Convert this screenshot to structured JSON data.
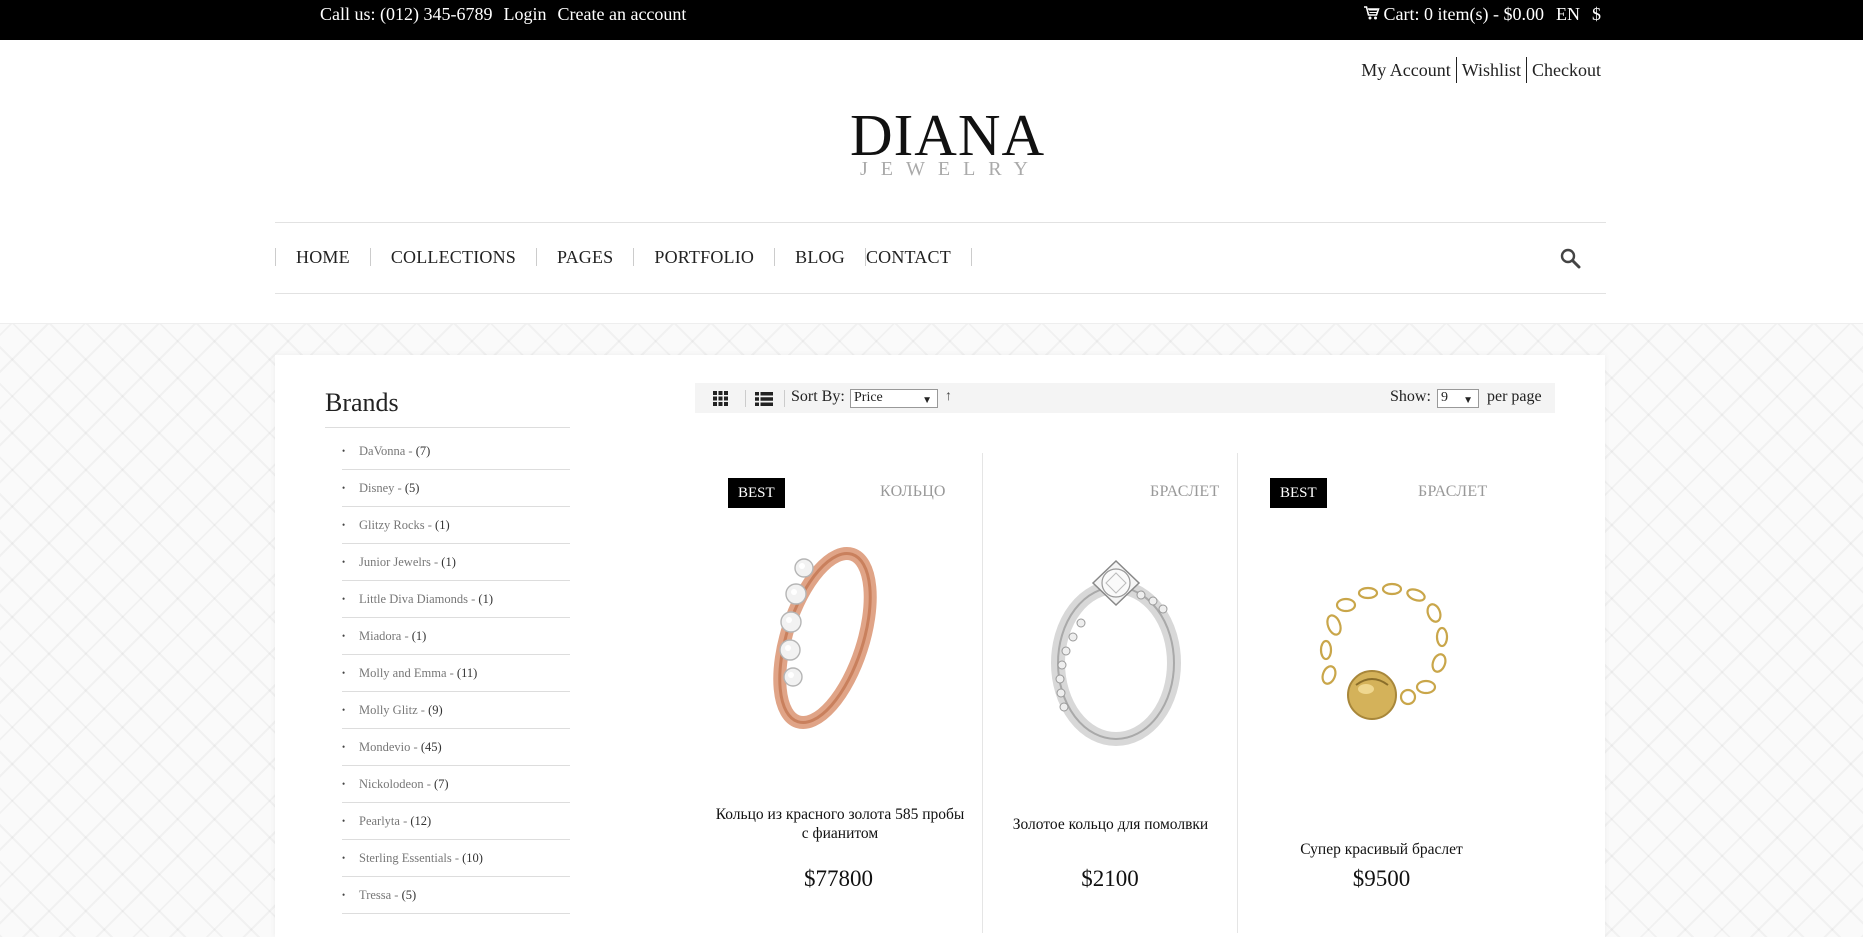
{
  "topbar": {
    "phone": "Call us: (012) 345-6789",
    "login": "Login",
    "create_account": "Create an account",
    "cart": "Cart: 0 item(s) - $0.00",
    "language": "EN",
    "currency": "$"
  },
  "header": {
    "links": [
      "My Account",
      "Wishlist",
      "Checkout"
    ],
    "logo_main": "DIANA",
    "logo_sub": "JEWELRY"
  },
  "nav": {
    "items": [
      "HOME",
      "COLLECTIONS",
      "PAGES",
      "PORTFOLIO",
      "BLOG",
      "CONTACT"
    ]
  },
  "sidebar": {
    "title": "Brands",
    "brands": [
      {
        "name": "DaVonna - ",
        "count": "(7)"
      },
      {
        "name": "Disney - ",
        "count": "(5)"
      },
      {
        "name": "Glitzy Rocks - ",
        "count": "(1)"
      },
      {
        "name": "Junior Jewelrs - ",
        "count": "(1)"
      },
      {
        "name": "Little Diva Diamonds - ",
        "count": "(1)"
      },
      {
        "name": "Miadora - ",
        "count": "(1)"
      },
      {
        "name": "Molly and Emma - ",
        "count": "(11)"
      },
      {
        "name": "Molly Glitz - ",
        "count": "(9)"
      },
      {
        "name": "Mondevio - ",
        "count": "(45)"
      },
      {
        "name": "Nickolodeon - ",
        "count": "(7)"
      },
      {
        "name": "Pearlyta - ",
        "count": "(12)"
      },
      {
        "name": "Sterling Essentials - ",
        "count": "(10)"
      },
      {
        "name": "Tressa - ",
        "count": "(5)"
      }
    ]
  },
  "toolbar": {
    "sort_label": "Sort By:",
    "sort_value": "Price",
    "show_label": "Show:",
    "show_value": "9",
    "per_page": "per page"
  },
  "products": [
    {
      "badge": "BEST",
      "category": "КОЛЬЦО",
      "name": "Кольцо из красного золота 585 пробы с фианитом",
      "price": "$77800"
    },
    {
      "badge": "",
      "category": "БРАСЛЕТ",
      "name": "Золотое кольцо для помолвки",
      "price": "$2100"
    },
    {
      "badge": "BEST",
      "category": "БРАСЛЕТ",
      "name": "Супер красивый браслет",
      "price": "$9500"
    }
  ],
  "colors": {
    "topbar_bg": "#000000",
    "badge_bg": "#000000",
    "category_text": "#999999"
  }
}
